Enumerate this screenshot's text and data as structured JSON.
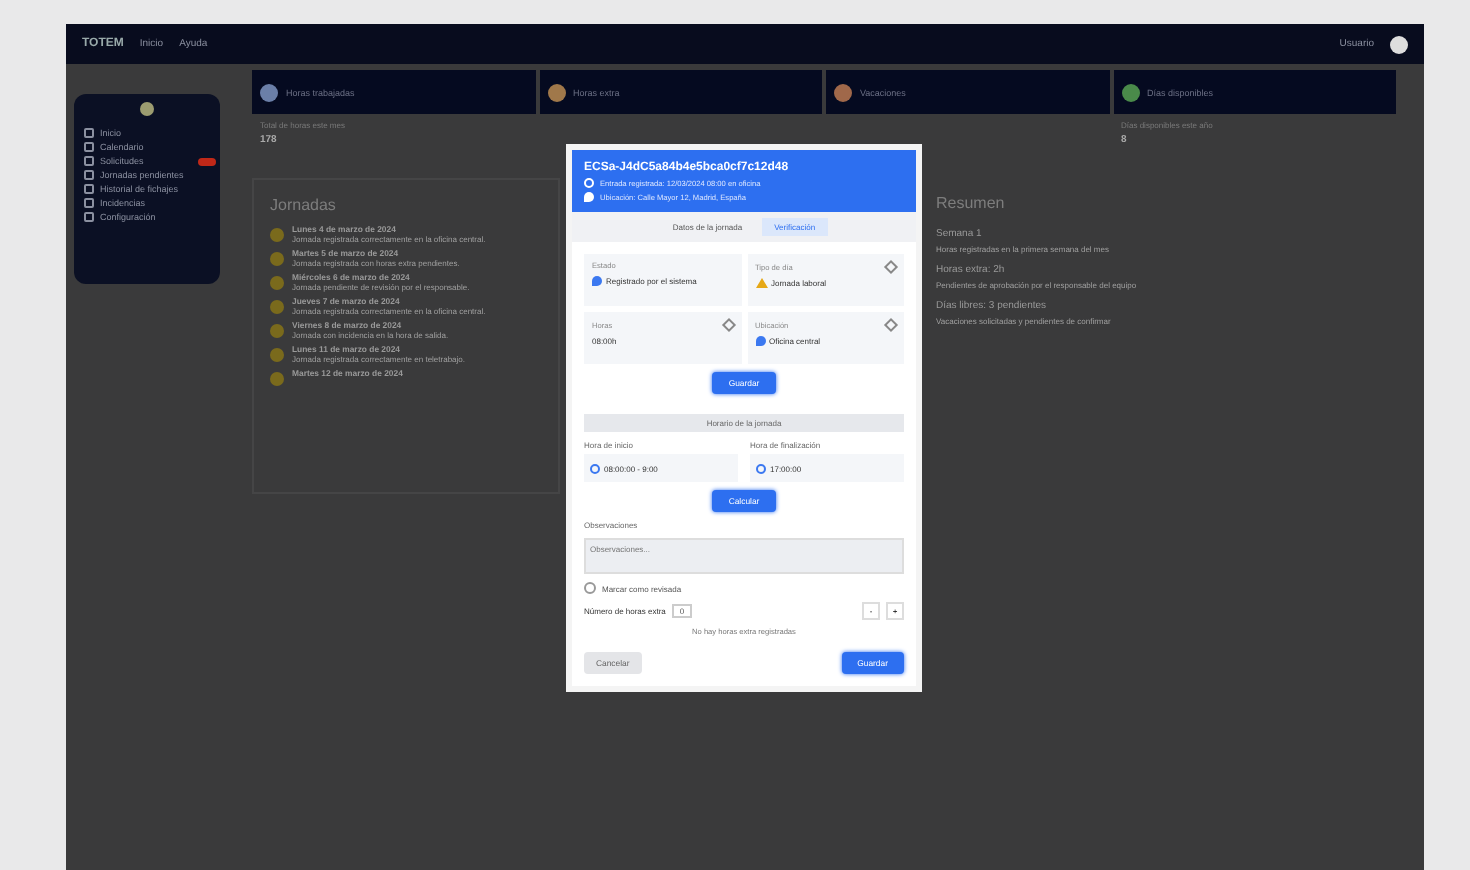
{
  "topbar": {
    "brand": "TOTEM",
    "links": [
      "Inicio",
      "Ayuda"
    ],
    "user": "Usuario"
  },
  "sidebar": {
    "items": [
      {
        "label": "Inicio",
        "alert": false
      },
      {
        "label": "Calendario",
        "alert": false
      },
      {
        "label": "Solicitudes",
        "alert": true
      },
      {
        "label": "Jornadas pendientes",
        "alert": false
      },
      {
        "label": "Historial de fichajes",
        "alert": false
      },
      {
        "label": "Incidencias",
        "alert": false
      },
      {
        "label": "Configuración",
        "alert": false
      }
    ]
  },
  "stat_cards": [
    {
      "title": "Horas trabajadas",
      "color": "#6b7fa8",
      "label": "Total de horas este mes",
      "value": "178"
    },
    {
      "title": "Horas extra",
      "color": "#a0784a"
    },
    {
      "title": "Vacaciones",
      "color": "#a0684a"
    },
    {
      "title": "Días disponibles",
      "color": "#4a8a4a",
      "label": "Días disponibles este año",
      "value": "8"
    }
  ],
  "jornadas": {
    "title": "Jornadas",
    "items": [
      {
        "title": "Lunes 4 de marzo de 2024",
        "text": "Jornada registrada correctamente en la oficina central."
      },
      {
        "title": "Martes 5 de marzo de 2024",
        "text": "Jornada registrada con horas extra pendientes."
      },
      {
        "title": "Miércoles 6 de marzo de 2024",
        "text": "Jornada pendiente de revisión por el responsable."
      },
      {
        "title": "Jueves 7 de marzo de 2024",
        "text": "Jornada registrada correctamente en la oficina central."
      },
      {
        "title": "Viernes 8 de marzo de 2024",
        "text": "Jornada con incidencia en la hora de salida."
      },
      {
        "title": "Lunes 11 de marzo de 2024",
        "text": "Jornada registrada correctamente en teletrabajo."
      },
      {
        "title": "Martes 12 de marzo de 2024"
      }
    ]
  },
  "summary": {
    "title": "Resumen",
    "items": [
      {
        "heading": "Semana 1",
        "text": "Horas registradas en la primera semana del mes"
      },
      {
        "heading": "Horas extra: 2h",
        "text": "Pendientes de aprobación por el responsable del equipo"
      },
      {
        "heading": "Días libres: 3 pendientes",
        "text": "Vacaciones solicitadas y pendientes de confirmar"
      }
    ]
  },
  "modal": {
    "title": "ECSa-J4dC5a84b4e5bca0cf7c12d48",
    "subtitles": [
      {
        "kind": "time",
        "text": "Entrada registrada: 12/03/2024 08:00 en oficina"
      },
      {
        "kind": "place",
        "text": "Ubicación: Calle Mayor 12, Madrid, España"
      }
    ],
    "tabs": [
      {
        "label": "Datos de la jornada",
        "selected": false
      },
      {
        "label": "Verificación",
        "selected": true
      }
    ],
    "info_cards": [
      {
        "label": "Estado",
        "value": "Registrado por el sistema",
        "kind": "place",
        "editable": false
      },
      {
        "label": "Tipo de día",
        "value": "Jornada laboral",
        "kind": "alert",
        "editable": true
      },
      {
        "label": "Horas",
        "value": "08:00h",
        "kind": "plain",
        "editable": true
      },
      {
        "label": "Ubicación",
        "value": "Oficina central",
        "kind": "place",
        "editable": true
      }
    ],
    "save_button": "Guardar",
    "section_title": "Horario de la jornada",
    "time_fields": [
      {
        "label": "Hora de inicio",
        "value": "08:00:00 - 9:00"
      },
      {
        "label": "Hora de finalización",
        "value": "17:00:00"
      }
    ],
    "calc_button": "Calcular",
    "notes": {
      "label": "Observaciones",
      "placeholder": "Observaciones..."
    },
    "review": {
      "label": "Marcar como revisada",
      "checked": false
    },
    "extra": {
      "label": "Número de horas extra",
      "value": "0",
      "buttons": [
        "-",
        "+"
      ]
    },
    "hint": "No hay horas extra registradas",
    "footer": {
      "cancel": "Cancelar",
      "confirm": "Guardar"
    }
  }
}
